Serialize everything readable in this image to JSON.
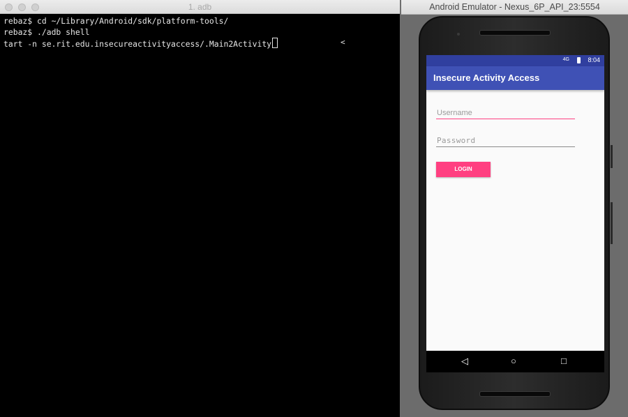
{
  "terminal": {
    "title": "1. adb",
    "lines": [
      "rebaz$ cd ~/Library/Android/sdk/platform-tools/",
      "rebaz$ ./adb shell",
      "tart -n se.rit.edu.insecureactivityaccess/.Main2Activity"
    ],
    "trailing_char": "<"
  },
  "emulator": {
    "title": "Android Emulator - Nexus_6P_API_23:5554",
    "status_bar": {
      "network": "4G",
      "time": "8:04"
    },
    "app": {
      "title": "Insecure Activity Access",
      "username_placeholder": "Username",
      "password_placeholder": "Password",
      "login_label": "LOGIN"
    },
    "nav_icons": [
      "back-icon",
      "home-icon",
      "recents-icon"
    ]
  },
  "colors": {
    "status_bar": "#303f9f",
    "app_bar": "#3f51b5",
    "accent": "#ff4081",
    "terminal_bg": "#000000"
  }
}
